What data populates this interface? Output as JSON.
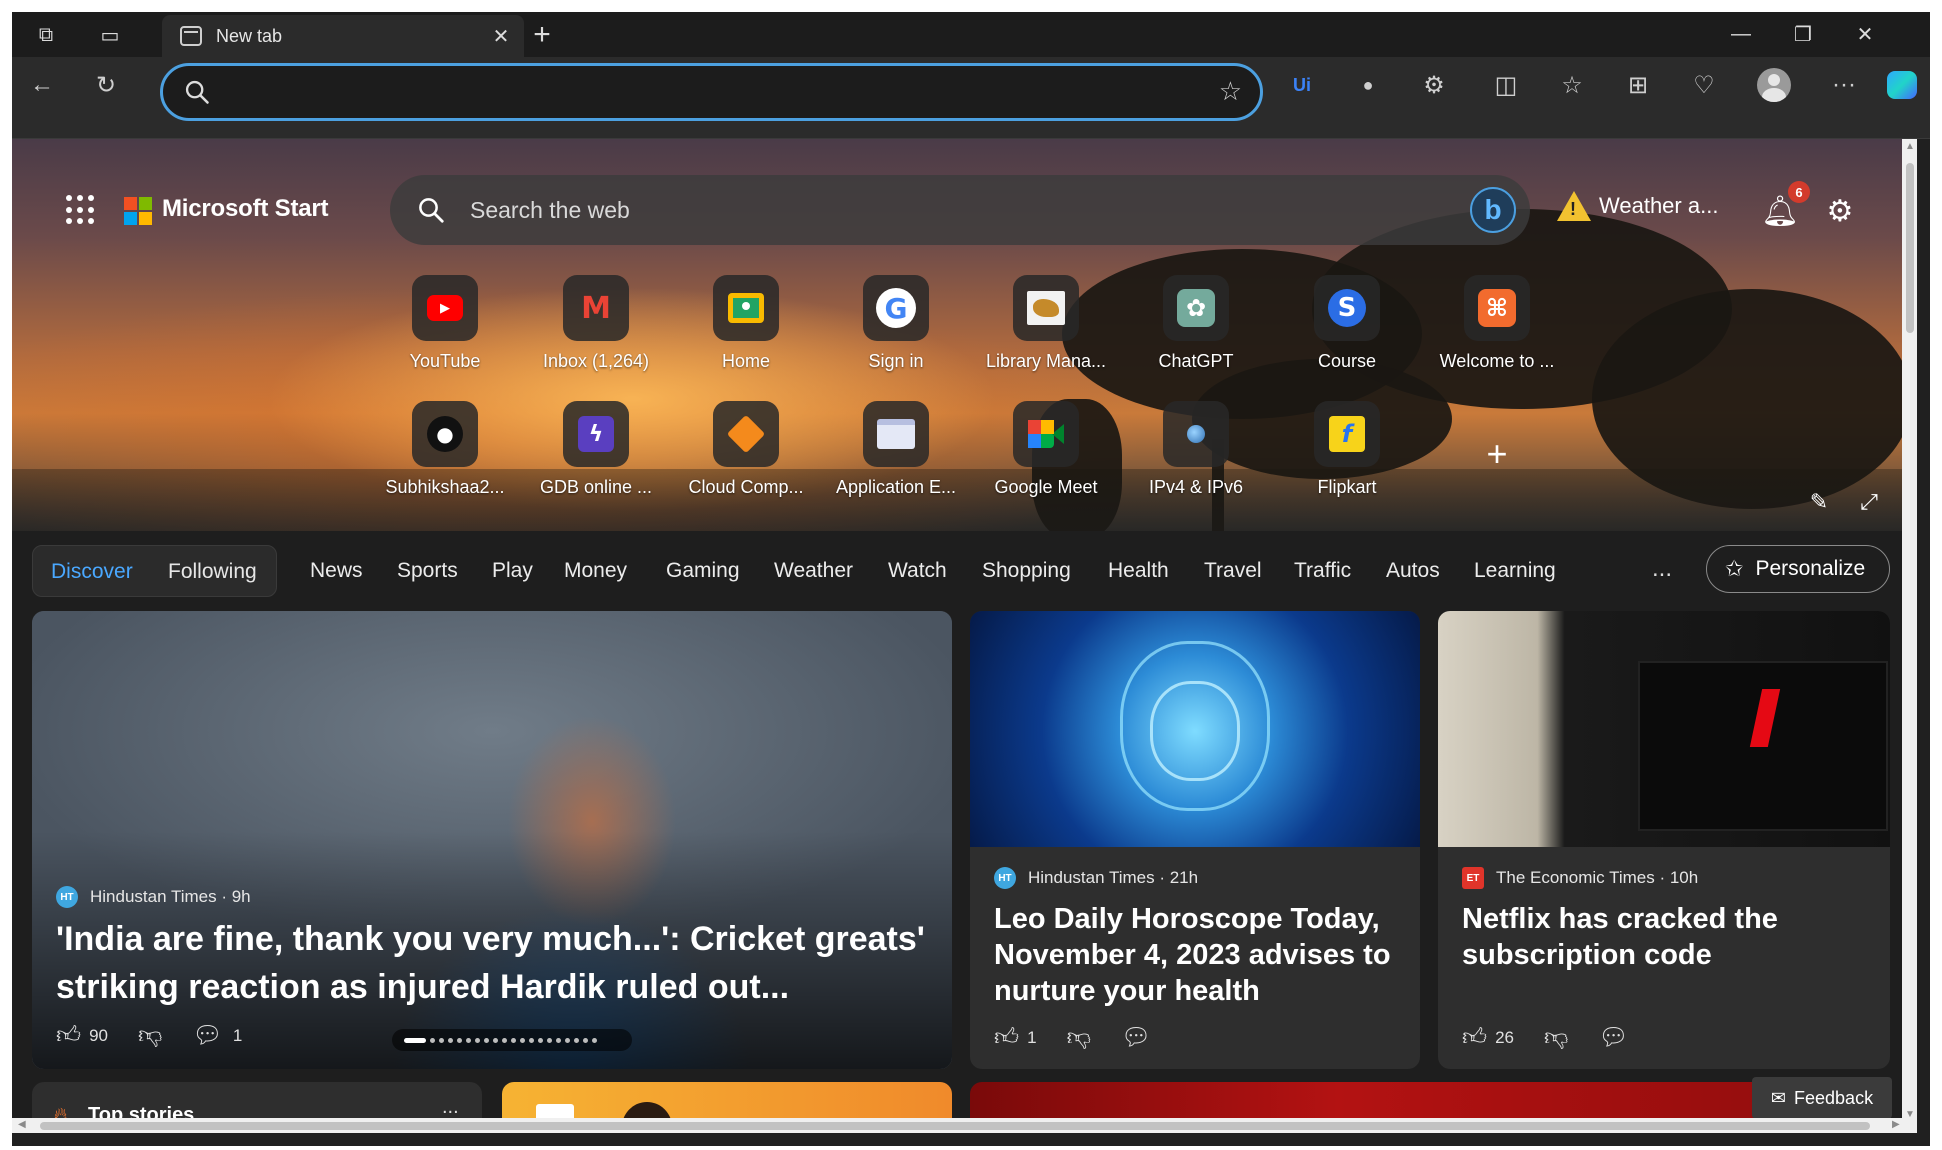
{
  "browser": {
    "tab_title": "New tab",
    "address_placeholder": "",
    "colors": {
      "accent": "#4ca0e0",
      "tabstrip": "#1c1c1c",
      "toolbar": "#2b2b2b"
    }
  },
  "header": {
    "brand": "Microsoft Start",
    "search_placeholder": "Search the web",
    "weather_label": "Weather a...",
    "notification_count": "6"
  },
  "quick_links": [
    {
      "label": "YouTube",
      "icon": "youtube-icon"
    },
    {
      "label": "Inbox (1,264)",
      "icon": "gmail-icon"
    },
    {
      "label": "Home",
      "icon": "classroom-icon"
    },
    {
      "label": "Sign in",
      "icon": "google-icon"
    },
    {
      "label": "Library Mana...",
      "icon": "library-icon"
    },
    {
      "label": "ChatGPT",
      "icon": "chatgpt-icon"
    },
    {
      "label": "Course",
      "icon": "course-icon"
    },
    {
      "label": "Welcome to ...",
      "icon": "welcome-icon"
    },
    {
      "label": "Subhikshaa2...",
      "icon": "github-icon"
    },
    {
      "label": "GDB online ...",
      "icon": "gdb-icon"
    },
    {
      "label": "Cloud Comp...",
      "icon": "cloud-icon"
    },
    {
      "label": "Application E...",
      "icon": "application-icon"
    },
    {
      "label": "Google Meet",
      "icon": "google-meet-icon"
    },
    {
      "label": "IPv4 & IPv6",
      "icon": "globe-icon"
    },
    {
      "label": "Flipkart",
      "icon": "flipkart-icon"
    }
  ],
  "nav": {
    "segment": [
      "Discover",
      "Following"
    ],
    "categories": [
      "News",
      "Sports",
      "Play",
      "Money",
      "Gaming",
      "Weather",
      "Watch",
      "Shopping",
      "Health",
      "Travel",
      "Traffic",
      "Autos",
      "Learning"
    ],
    "more": "...",
    "personalize": "Personalize"
  },
  "cards": [
    {
      "source": "Hindustan Times · 9h",
      "headline": "'India are fine, thank you very much...': Cricket greats' striking reaction as injured Hardik ruled out...",
      "likes": "90",
      "comments": "1"
    },
    {
      "source": "Hindustan Times · 21h",
      "headline": "Leo Daily Horoscope Today, November 4, 2023 advises to nurture your health",
      "likes": "1",
      "comments": ""
    },
    {
      "source": "The Economic Times · 10h",
      "headline": "Netflix has cracked the subscription code",
      "likes": "26",
      "comments": ""
    }
  ],
  "bottom": {
    "top_stories": "Top stories",
    "more": "...",
    "feedback": "Feedback"
  }
}
